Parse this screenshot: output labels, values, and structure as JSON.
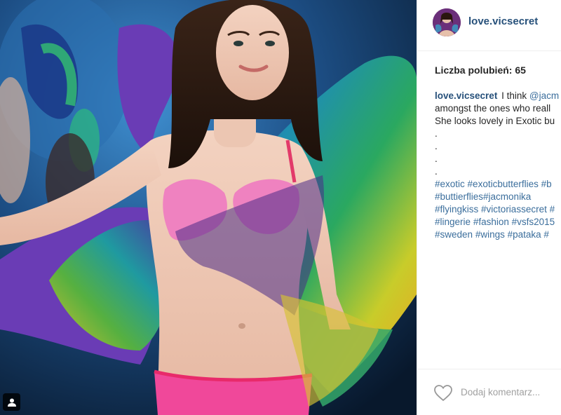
{
  "post": {
    "username": "love.vicsecret",
    "likes_label": "Liczba polubień: 65",
    "caption": {
      "author": "love.vicsecret",
      "line1_text": "I think ",
      "line1_mention": "@jacm",
      "line2": "amongst the ones who reall",
      "line3": "She looks lovely in Exotic bu",
      "dots": [
        ".",
        ".",
        ".",
        "."
      ],
      "hashtag_lines": [
        [
          "#exotic",
          "#exoticbutterflies",
          "#b"
        ],
        [
          "#buttierflies#jacmonika"
        ],
        [
          "#flyingkiss",
          "#victoriassecret",
          "#"
        ],
        [
          "#lingerie",
          "#fashion",
          "#vsfs2015"
        ],
        [
          "#sweden",
          "#wings",
          "#pataka",
          "#"
        ]
      ]
    },
    "comment_placeholder": "Dodaj komentarz..."
  },
  "icons": {
    "heart": "heart-icon",
    "avatar": "avatar",
    "photo_badge": "user-tag-icon"
  },
  "colors": {
    "username": "#26507a",
    "hashtag": "#3b6e9c",
    "text": "#262626",
    "placeholder": "#a0a0a0"
  }
}
